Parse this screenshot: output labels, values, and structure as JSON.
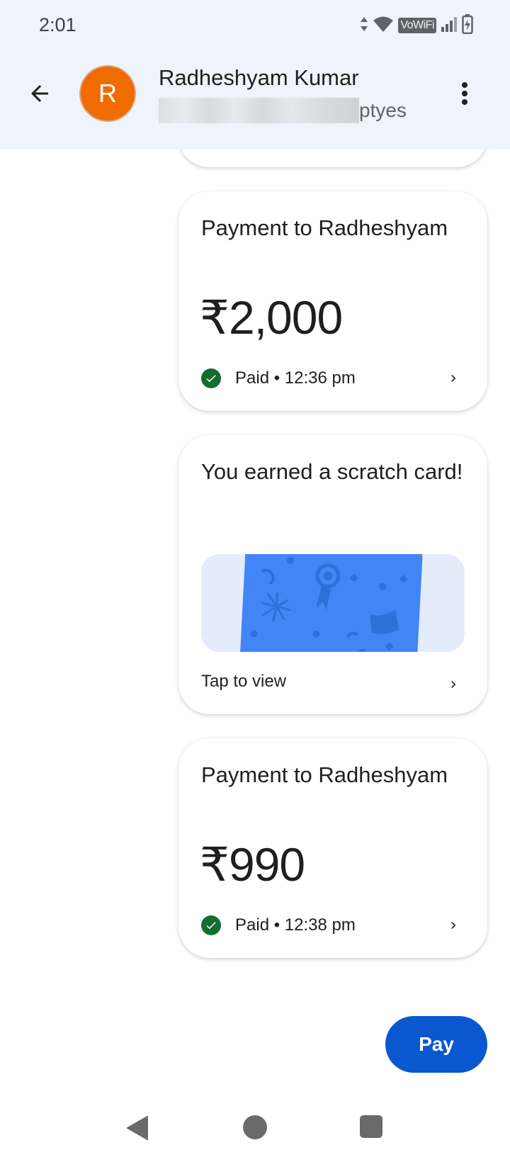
{
  "status_bar": {
    "time": "2:01",
    "network_label": "VoWiFi",
    "icons": [
      "data-arrows-icon",
      "wifi-icon",
      "vowifi-badge",
      "signal-icon",
      "battery-charging-icon"
    ]
  },
  "header": {
    "avatar_initial": "R",
    "avatar_color": "#ef6c00",
    "contact_name": "Radheshyam Kumar",
    "contact_sub_visible": "ptyes"
  },
  "messages": [
    {
      "type": "payment",
      "title": "Payment to Radheshyam",
      "amount": "₹2,000",
      "status": "Paid • 12:36 pm"
    },
    {
      "type": "scratch_card",
      "title": "You earned a scratch card!",
      "action": "Tap to view"
    },
    {
      "type": "payment",
      "title": "Payment to Radheshyam",
      "amount": "₹990",
      "status": "Paid • 12:38 pm"
    }
  ],
  "fab": {
    "label": "Pay",
    "color": "#0b57d0"
  },
  "colors": {
    "header_bg": "#eff3fb",
    "paid_green": "#146c2e",
    "scratch_blue": "#4285f4"
  }
}
